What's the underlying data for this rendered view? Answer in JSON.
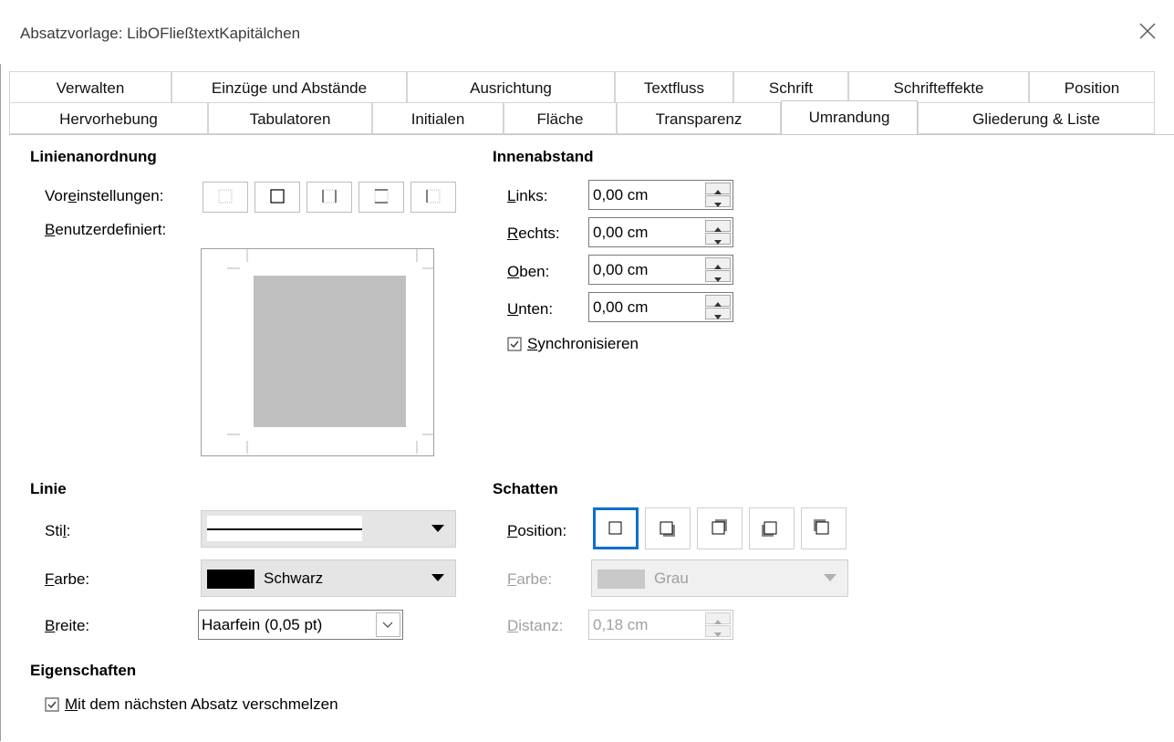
{
  "window": {
    "title": "Absatzvorlage: LibOFließtextKapitälchen"
  },
  "tabs": {
    "row1": [
      "Verwalten",
      "Einzüge und Abstände",
      "Ausrichtung",
      "Textfluss",
      "Schrift",
      "Schrifteffekte",
      "Position"
    ],
    "row2": [
      "Hervorhebung",
      "Tabulatoren",
      "Initialen",
      "Fläche",
      "Transparenz",
      "Umrandung",
      "Gliederung & Liste"
    ],
    "active": "Umrandung"
  },
  "linienanordnung": {
    "heading": "Linienanordnung",
    "presets_label": "Voreinstellungen:",
    "custom_label": "Benutzerdefiniert:"
  },
  "innenabstand": {
    "heading": "Innenabstand",
    "links_label": "Links:",
    "links_value": "0,00 cm",
    "rechts_label": "Rechts:",
    "rechts_value": "0,00 cm",
    "oben_label": "Oben:",
    "oben_value": "0,00 cm",
    "unten_label": "Unten:",
    "unten_value": "0,00 cm",
    "sync_label": "Synchronisieren",
    "sync_checked": true
  },
  "linie": {
    "heading": "Linie",
    "stil_label": "Stil:",
    "farbe_label": "Farbe:",
    "farbe_value": "Schwarz",
    "farbe_swatch": "#000000",
    "breite_label": "Breite:",
    "breite_value": "Haarfein (0,05 pt)"
  },
  "schatten": {
    "heading": "Schatten",
    "position_label": "Position:",
    "farbe_label": "Farbe:",
    "farbe_value": "Grau",
    "farbe_swatch": "#c8c8c8",
    "distanz_label": "Distanz:",
    "distanz_value": "0,18 cm"
  },
  "eigenschaften": {
    "heading": "Eigenschaften",
    "merge_label": "Mit dem nächsten Absatz verschmelzen",
    "merge_checked": true
  },
  "colors": {
    "accent": "#0a6fd6",
    "preview_fill": "#c0c0c0"
  }
}
